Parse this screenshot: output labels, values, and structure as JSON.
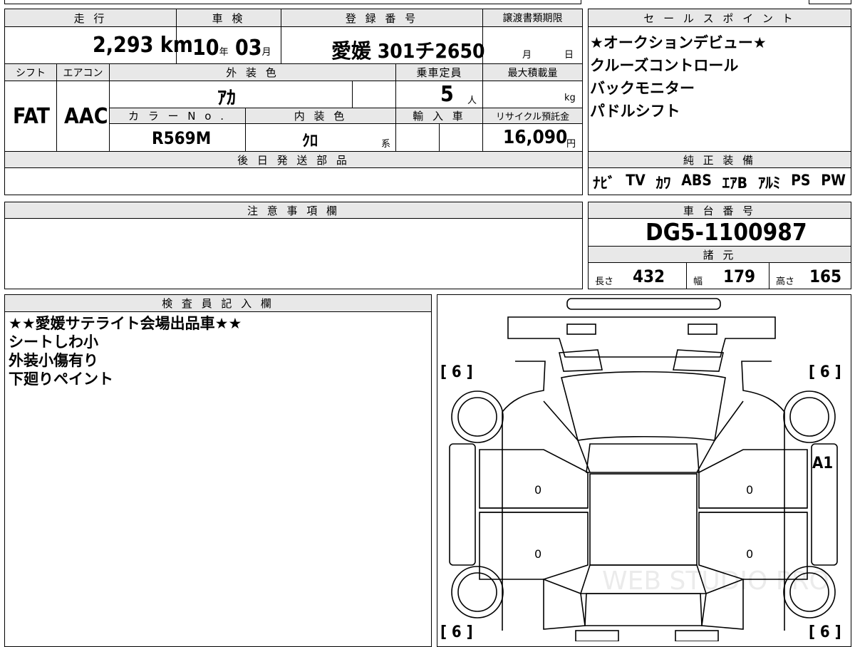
{
  "top_sheet": {
    "headers": {
      "mileage": "走 行",
      "shaken": "車 検",
      "registration": "登 録 番 号",
      "transfer_deadline": "譲渡書類期限",
      "shift": "シフト",
      "aircon": "エアコン",
      "exterior_color": "外 装 色",
      "capacity": "乗車定員",
      "max_load": "最大積載量",
      "color_no": "カ ラ ー N o .",
      "interior_color": "内 装 色",
      "import": "輸 入 車",
      "recycle": "リサイクル預託金",
      "later_parts": "後 日 発 送 部 品"
    },
    "mileage": {
      "value": "2,293",
      "unit": "km"
    },
    "shaken": {
      "year": "10",
      "year_unit": "年",
      "month": "03",
      "month_unit": "月"
    },
    "registration": {
      "area": "愛媛",
      "class": "301",
      "kana": "チ",
      "number": "2650"
    },
    "transfer_deadline": {
      "month_unit": "月",
      "day_unit": "日"
    },
    "shift": "FAT",
    "aircon": "AAC",
    "exterior_color": "ｱｶ",
    "capacity": {
      "value": "5",
      "unit": "人"
    },
    "max_load": {
      "unit": "kg"
    },
    "color_no": "R569M",
    "interior_color": {
      "value": "ｸﾛ",
      "suffix": "系"
    },
    "recycle": {
      "value": "16,090",
      "unit": "円"
    }
  },
  "sales_points": {
    "header": "セ ー ル ス ポ イ ン ト",
    "items": [
      "★オークションデビュー★",
      "クルーズコントロール",
      "バックモニター",
      "パドルシフト"
    ]
  },
  "genuine_equipment": {
    "header": "純 正 装 備",
    "items": [
      "ﾅﾋﾞ",
      "TV",
      "ｶﾜ",
      "ABS",
      "ｴｱB",
      "ｱﾙﾐ",
      "PS",
      "PW"
    ]
  },
  "notes": {
    "header": "注 意 事 項 欄"
  },
  "chassis": {
    "header": "車 台 番 号",
    "number": "DG5-1100987"
  },
  "specs": {
    "header": "諸 元",
    "length_label": "長さ",
    "length": "432",
    "width_label": "幅",
    "width": "179",
    "height_label": "高さ",
    "height": "165"
  },
  "inspector": {
    "header": "検 査 員 記 入 欄",
    "lines": [
      "★★愛媛サテライト会場出品車★★",
      "シートしわ小",
      "外装小傷有り",
      "下廻りペイント"
    ]
  },
  "diagram": {
    "tire_marks": [
      "[ 6 ]",
      "[ 6 ]",
      "[ 6 ]",
      "[ 6 ]"
    ],
    "damage_code": "A1",
    "panel_marks": [
      "0",
      "0",
      "0",
      "0"
    ],
    "watermark": "WEB STUDIO PRO"
  }
}
